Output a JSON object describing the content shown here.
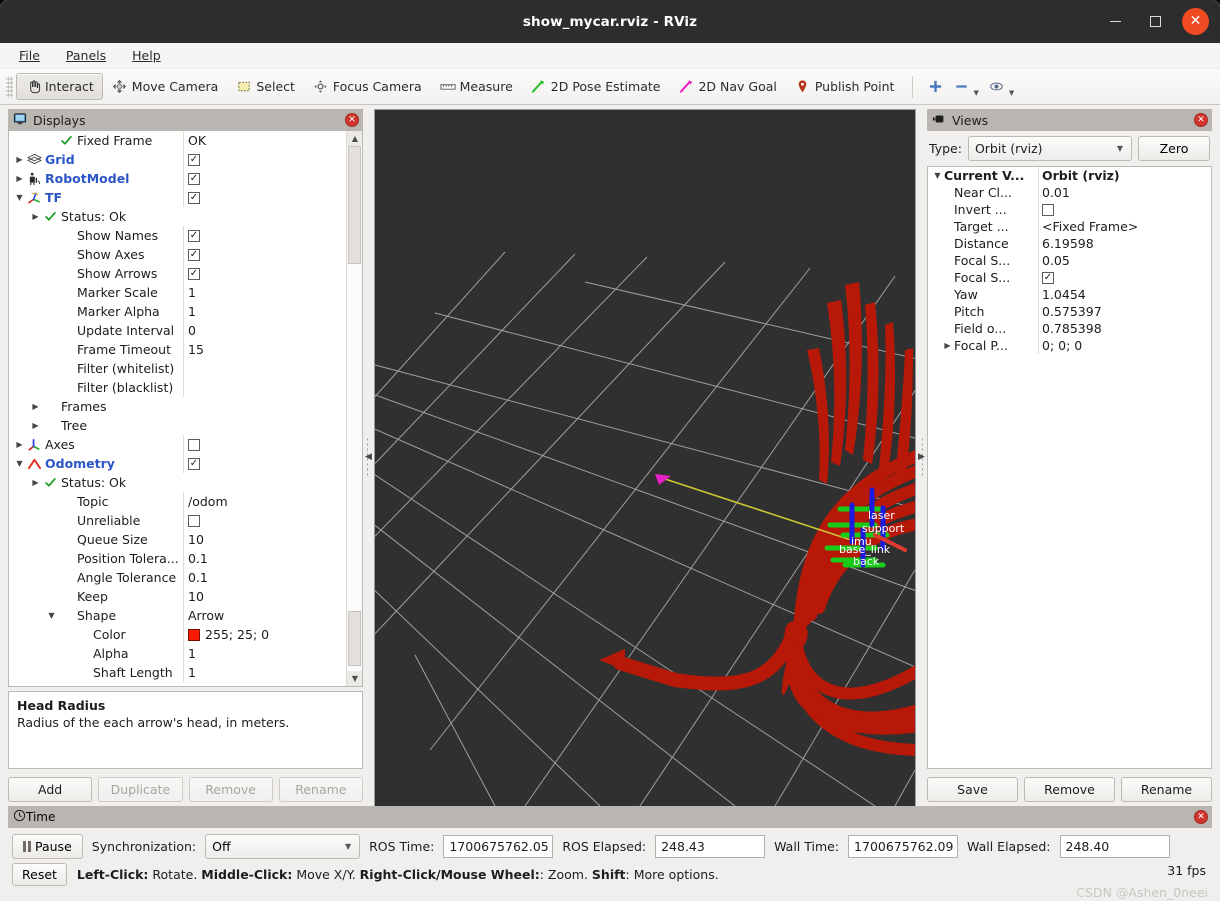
{
  "window": {
    "title": "show_mycar.rviz - RViz",
    "minimize_icon": "minimize-icon",
    "maximize_icon": "maximize-icon",
    "close_icon": "close-icon",
    "close_glyph": "✕"
  },
  "menubar": {
    "items": [
      "File",
      "Panels",
      "Help"
    ]
  },
  "toolbar": {
    "buttons": [
      {
        "label": "Interact",
        "icon": "hand-cursor-icon",
        "active": true
      },
      {
        "label": "Move Camera",
        "icon": "move-camera-icon",
        "active": false
      },
      {
        "label": "Select",
        "icon": "select-rect-icon",
        "active": false
      },
      {
        "label": "Focus Camera",
        "icon": "focus-camera-icon",
        "active": false
      },
      {
        "label": "Measure",
        "icon": "ruler-icon",
        "active": false
      },
      {
        "label": "2D Pose Estimate",
        "icon": "green-arrow-icon",
        "active": false
      },
      {
        "label": "2D Nav Goal",
        "icon": "magenta-arrow-icon",
        "active": false
      },
      {
        "label": "Publish Point",
        "icon": "map-pin-icon",
        "active": false
      }
    ],
    "extra": [
      {
        "name": "add-tool-icon",
        "glyph": "✚"
      },
      {
        "name": "remove-tool-icon",
        "glyph": "─"
      },
      {
        "name": "visibility-eye-icon",
        "glyph": "◉"
      }
    ]
  },
  "displays": {
    "header": "Displays",
    "header_icon": "monitor-icon",
    "close_icon": "close-panel-icon",
    "rows": [
      {
        "indent": 2,
        "expander": "",
        "icon": "status-ok-check",
        "label": "Fixed Frame",
        "bold": false,
        "value": "OK",
        "value_type": "text"
      },
      {
        "indent": 0,
        "expander": "▶",
        "icon": "grid-icon",
        "label": "Grid",
        "bold": true,
        "value": "checked",
        "value_type": "checkbox"
      },
      {
        "indent": 0,
        "expander": "▶",
        "icon": "robot-icon",
        "label": "RobotModel",
        "bold": true,
        "value": "checked",
        "value_type": "checkbox"
      },
      {
        "indent": 0,
        "expander": "▼",
        "icon": "tf-axes-icon",
        "label": "TF",
        "bold": true,
        "value": "checked",
        "value_type": "checkbox"
      },
      {
        "indent": 1,
        "expander": "▶",
        "icon": "status-ok-check",
        "label": "Status: Ok",
        "bold": false,
        "value": "",
        "value_type": "none"
      },
      {
        "indent": 2,
        "expander": "",
        "icon": "",
        "label": "Show Names",
        "bold": false,
        "value": "checked",
        "value_type": "checkbox"
      },
      {
        "indent": 2,
        "expander": "",
        "icon": "",
        "label": "Show Axes",
        "bold": false,
        "value": "checked",
        "value_type": "checkbox"
      },
      {
        "indent": 2,
        "expander": "",
        "icon": "",
        "label": "Show Arrows",
        "bold": false,
        "value": "checked",
        "value_type": "checkbox"
      },
      {
        "indent": 2,
        "expander": "",
        "icon": "",
        "label": "Marker Scale",
        "bold": false,
        "value": "1",
        "value_type": "text"
      },
      {
        "indent": 2,
        "expander": "",
        "icon": "",
        "label": "Marker Alpha",
        "bold": false,
        "value": "1",
        "value_type": "text"
      },
      {
        "indent": 2,
        "expander": "",
        "icon": "",
        "label": "Update Interval",
        "bold": false,
        "value": "0",
        "value_type": "text"
      },
      {
        "indent": 2,
        "expander": "",
        "icon": "",
        "label": "Frame Timeout",
        "bold": false,
        "value": "15",
        "value_type": "text"
      },
      {
        "indent": 2,
        "expander": "",
        "icon": "",
        "label": "Filter (whitelist)",
        "bold": false,
        "value": "",
        "value_type": "text"
      },
      {
        "indent": 2,
        "expander": "",
        "icon": "",
        "label": "Filter (blacklist)",
        "bold": false,
        "value": "",
        "value_type": "text"
      },
      {
        "indent": 1,
        "expander": "▶",
        "icon": "",
        "label": "Frames",
        "bold": false,
        "value": "",
        "value_type": "none"
      },
      {
        "indent": 1,
        "expander": "▶",
        "icon": "",
        "label": "Tree",
        "bold": false,
        "value": "",
        "value_type": "none"
      },
      {
        "indent": 0,
        "expander": "▶",
        "icon": "axes-icon",
        "label": "Axes",
        "bold": false,
        "value": "unchecked",
        "value_type": "checkbox"
      },
      {
        "indent": 0,
        "expander": "▼",
        "icon": "odometry-icon",
        "label": "Odometry",
        "bold": true,
        "value": "checked",
        "value_type": "checkbox"
      },
      {
        "indent": 1,
        "expander": "▶",
        "icon": "status-ok-check",
        "label": "Status: Ok",
        "bold": false,
        "value": "",
        "value_type": "none"
      },
      {
        "indent": 2,
        "expander": "",
        "icon": "",
        "label": "Topic",
        "bold": false,
        "value": "/odom",
        "value_type": "text"
      },
      {
        "indent": 2,
        "expander": "",
        "icon": "",
        "label": "Unreliable",
        "bold": false,
        "value": "unchecked",
        "value_type": "checkbox"
      },
      {
        "indent": 2,
        "expander": "",
        "icon": "",
        "label": "Queue Size",
        "bold": false,
        "value": "10",
        "value_type": "text"
      },
      {
        "indent": 2,
        "expander": "",
        "icon": "",
        "label": "Position Tolera...",
        "bold": false,
        "value": "0.1",
        "value_type": "text"
      },
      {
        "indent": 2,
        "expander": "",
        "icon": "",
        "label": "Angle Tolerance",
        "bold": false,
        "value": "0.1",
        "value_type": "text"
      },
      {
        "indent": 2,
        "expander": "",
        "icon": "",
        "label": "Keep",
        "bold": false,
        "value": "10",
        "value_type": "text"
      },
      {
        "indent": 2,
        "expander": "▼",
        "icon": "",
        "label": "Shape",
        "bold": false,
        "value": "Arrow",
        "value_type": "text"
      },
      {
        "indent": 3,
        "expander": "",
        "icon": "",
        "label": "Color",
        "bold": false,
        "value": "255; 25; 0",
        "value_type": "color",
        "color": "#ff1900"
      },
      {
        "indent": 3,
        "expander": "",
        "icon": "",
        "label": "Alpha",
        "bold": false,
        "value": "1",
        "value_type": "text"
      },
      {
        "indent": 3,
        "expander": "",
        "icon": "",
        "label": "Shaft Length",
        "bold": false,
        "value": "1",
        "value_type": "text"
      }
    ],
    "description": {
      "title": "Head Radius",
      "body": "Radius of the each arrow's head, in meters."
    },
    "buttons": [
      {
        "label": "Add",
        "enabled": true
      },
      {
        "label": "Duplicate",
        "enabled": false
      },
      {
        "label": "Remove",
        "enabled": false
      },
      {
        "label": "Rename",
        "enabled": false
      }
    ]
  },
  "views": {
    "header": "Views",
    "header_icon": "camera-icon",
    "close_icon": "close-panel-icon",
    "type_label": "Type:",
    "type_value": "Orbit (rviz)",
    "zero_button": "Zero",
    "rows": [
      {
        "indent": 0,
        "expander": "▼",
        "label": "Current V...",
        "bold": true,
        "value": "Orbit (rviz)",
        "value_type": "text"
      },
      {
        "indent": 1,
        "expander": "",
        "label": "Near Cl...",
        "bold": false,
        "value": "0.01",
        "value_type": "text"
      },
      {
        "indent": 1,
        "expander": "",
        "label": "Invert ...",
        "bold": false,
        "value": "unchecked",
        "value_type": "checkbox"
      },
      {
        "indent": 1,
        "expander": "",
        "label": "Target ...",
        "bold": false,
        "value": "<Fixed Frame>",
        "value_type": "text"
      },
      {
        "indent": 1,
        "expander": "",
        "label": "Distance",
        "bold": false,
        "value": "6.19598",
        "value_type": "text"
      },
      {
        "indent": 1,
        "expander": "",
        "label": "Focal S...",
        "bold": false,
        "value": "0.05",
        "value_type": "text"
      },
      {
        "indent": 1,
        "expander": "",
        "label": "Focal S...",
        "bold": false,
        "value": "checked",
        "value_type": "checkbox"
      },
      {
        "indent": 1,
        "expander": "",
        "label": "Yaw",
        "bold": false,
        "value": "1.0454",
        "value_type": "text"
      },
      {
        "indent": 1,
        "expander": "",
        "label": "Pitch",
        "bold": false,
        "value": "0.575397",
        "value_type": "text"
      },
      {
        "indent": 1,
        "expander": "",
        "label": "Field o...",
        "bold": false,
        "value": "0.785398",
        "value_type": "text"
      },
      {
        "indent": 1,
        "expander": "▶",
        "label": "Focal P...",
        "bold": false,
        "value": "0; 0; 0",
        "value_type": "text"
      }
    ],
    "buttons": [
      {
        "label": "Save"
      },
      {
        "label": "Remove"
      },
      {
        "label": "Rename"
      }
    ]
  },
  "time": {
    "header": "Time",
    "header_icon": "clock-icon",
    "close_icon": "close-panel-icon",
    "pause_label": "Pause",
    "sync_label": "Synchronization:",
    "sync_value": "Off",
    "ros_time_label": "ROS Time:",
    "ros_time_value": "1700675762.05",
    "ros_elapsed_label": "ROS Elapsed:",
    "ros_elapsed_value": "248.43",
    "wall_time_label": "Wall Time:",
    "wall_time_value": "1700675762.09",
    "wall_elapsed_label": "Wall Elapsed:",
    "wall_elapsed_value": "248.40",
    "reset_label": "Reset",
    "hints": [
      {
        "bold": "Left-Click:",
        "normal": " Rotate."
      },
      {
        "bold": "Middle-Click:",
        "normal": " Move X/Y."
      },
      {
        "bold": "Right-Click/Mouse Wheel:",
        "normal": ": Zoom."
      },
      {
        "bold": "Shift",
        "normal": ": More options."
      }
    ],
    "fps": "31 fps",
    "watermark": "CSDN @Ashen_0neei"
  },
  "viewport": {
    "background_color": "#303030",
    "grid_color": "#a6a6a6",
    "odom_arrow_color": "#ff1900",
    "nav_line_color": "#cdc832",
    "nav_arrow_color": "#e81ec8",
    "tf_labels": [
      "laser",
      "support",
      "imu",
      "base_link",
      "back"
    ]
  }
}
